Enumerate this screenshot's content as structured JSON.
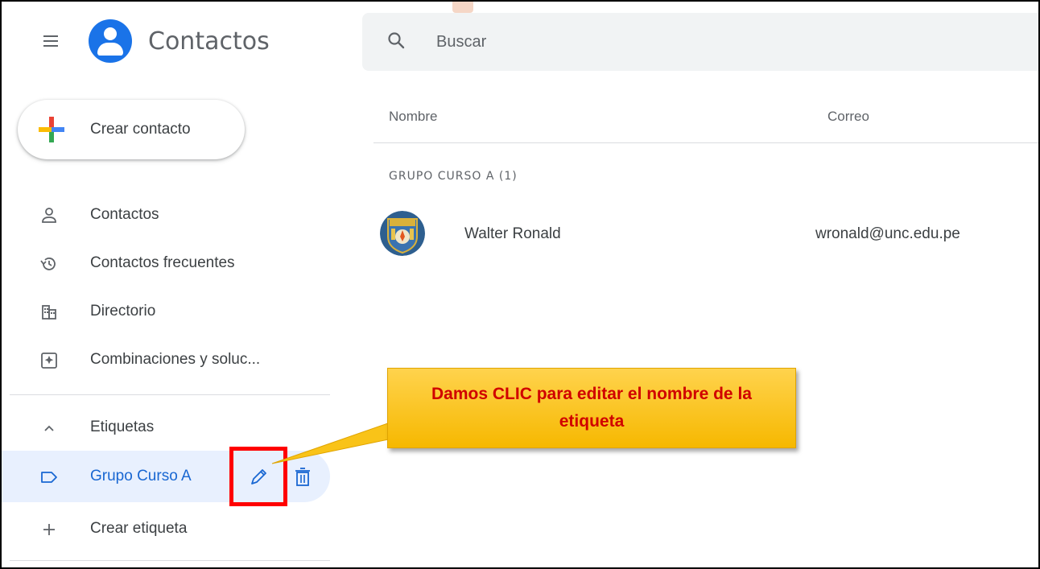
{
  "app": {
    "title": "Contactos",
    "brand_color": "#1a73e8"
  },
  "search": {
    "placeholder": "Buscar",
    "icon": "search-icon"
  },
  "sidebar": {
    "create_label": "Crear contacto",
    "items": [
      {
        "label": "Contactos",
        "icon": "person-icon"
      },
      {
        "label": "Contactos frecuentes",
        "icon": "history-icon"
      },
      {
        "label": "Directorio",
        "icon": "directory-icon"
      },
      {
        "label": "Combinaciones y soluc...",
        "icon": "merge-icon"
      }
    ],
    "labels_section": {
      "title": "Etiquetas",
      "toggle_icon": "chevron-up-icon",
      "active_label": "Grupo Curso A",
      "create_label": "Crear etiqueta"
    },
    "active_color": "#1967d2"
  },
  "list": {
    "columns": [
      "Nombre",
      "Correo"
    ],
    "group_heading": "GRUPO CURSO A (1)",
    "contacts": [
      {
        "name": "Walter Ronald",
        "email": "wronald@unc.edu.pe"
      }
    ]
  },
  "callout": {
    "text": "Damos CLIC para editar el nombre de la etiqueta",
    "text_color": "#d00000",
    "fill_color": "#fbc02d",
    "highlight_color": "#ff0000"
  }
}
